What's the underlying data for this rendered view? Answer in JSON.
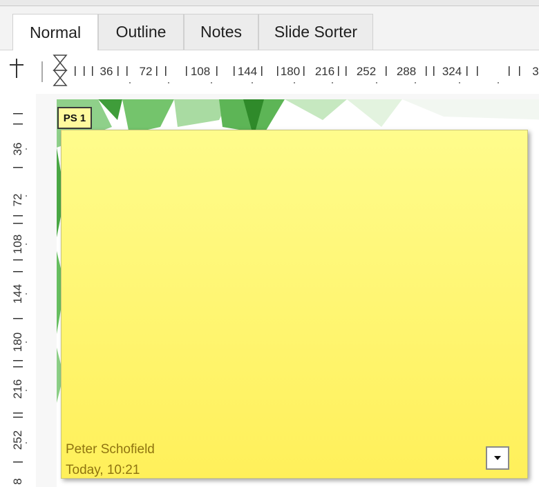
{
  "tabs": [
    {
      "label": "Normal",
      "active": true
    },
    {
      "label": "Outline",
      "active": false
    },
    {
      "label": "Notes",
      "active": false
    },
    {
      "label": "Slide Sorter",
      "active": false
    }
  ],
  "ruler": {
    "horizontal_labels": [
      "36",
      "72",
      "108",
      "144",
      "180",
      "216",
      "252",
      "288",
      "324",
      "3"
    ],
    "vertical_labels": [
      "36",
      "72",
      "108",
      "144",
      "180",
      "216",
      "252",
      "8"
    ]
  },
  "comment": {
    "marker": "PS 1",
    "author": "Peter Schofield",
    "date": "Today, 10:21",
    "menu_icon": "dropdown-arrow-icon",
    "background_color": "#fff47a"
  }
}
